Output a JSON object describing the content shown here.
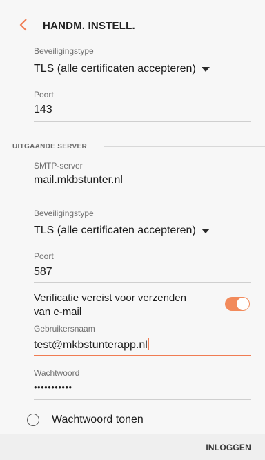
{
  "header": {
    "title": "HANDM. INSTELL.",
    "back_icon": "chevron-left-icon",
    "accent_color": "#f07c53"
  },
  "incoming": {
    "security_label": "Beveiligingstype",
    "security_value": "TLS (alle certificaten accepteren)",
    "port_label": "Poort",
    "port_value": "143"
  },
  "outgoing": {
    "section_title": "UITGAANDE SERVER",
    "smtp_label": "SMTP-server",
    "smtp_value": "mail.mkbstunter.nl",
    "security_label": "Beveiligingstype",
    "security_value": "TLS (alle certificaten accepteren)",
    "port_label": "Poort",
    "port_value": "587",
    "auth_label_line1": "Verificatie vereist voor verzenden",
    "auth_label_line2": "van e-mail",
    "auth_enabled": true,
    "username_label": "Gebruikersnaam",
    "username_value": "test@mkbstunterapp.nl",
    "password_label": "Wachtwoord",
    "password_value": "•••••••••••",
    "show_password_label": "Wachtwoord tonen",
    "show_password_checked": false
  },
  "footer": {
    "login_label": "INLOGGEN"
  }
}
